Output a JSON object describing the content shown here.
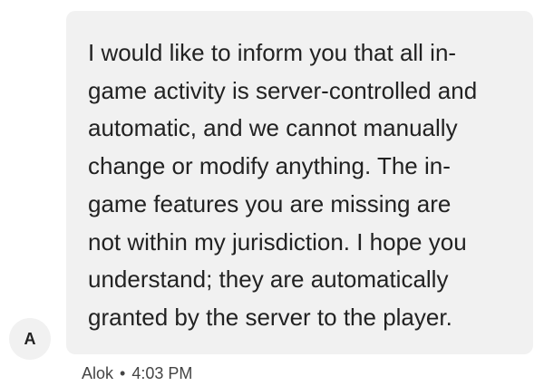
{
  "message": {
    "text": "I would like to inform you that all in-\ngame activity is server-controlled and\nautomatic, and we cannot manually\nchange or modify anything. The in-\ngame features you are missing are\nnot within my jurisdiction. I hope you\nunderstand; they are automatically\ngranted by the server to the player.",
    "sender": "Alok",
    "separator": "•",
    "time": "4:03 PM"
  },
  "avatar": {
    "initial": "A"
  },
  "colors": {
    "bubble": "#f1f1f1",
    "text": "#222222",
    "meta": "#444444"
  }
}
